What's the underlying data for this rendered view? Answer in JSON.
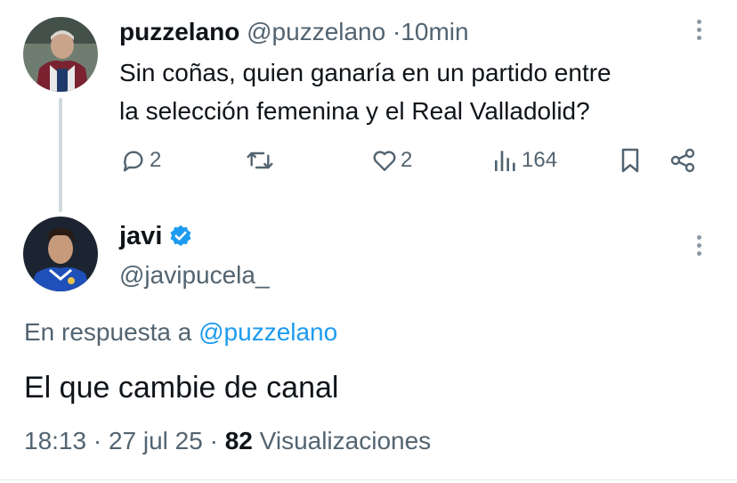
{
  "parent_tweet": {
    "author_name": "puzzelano",
    "author_handle": "@puzzelano",
    "separator": "·",
    "time_ago": "10min",
    "text_line1": "Sin coñas, quien ganaría en un partido entre",
    "text_line2": "la selección femenina y el Real Valladolid?",
    "actions": {
      "replies": "2",
      "likes": "2",
      "views": "164"
    },
    "avatar_icon": "avatar-photo-man-icon"
  },
  "reply_tweet": {
    "author_name": "javi",
    "author_handle": "@javipucela_",
    "verified": true,
    "reply_prefix": "En respuesta a",
    "reply_mention": "@puzzelano",
    "text": "El que cambie de canal",
    "time": "18:13",
    "date": "27 jul 25",
    "meta_separator": "·",
    "views_count": "82",
    "views_label": "Visualizaciones",
    "avatar_icon": "avatar-photo-young-man-icon"
  },
  "colors": {
    "text": "#0f1419",
    "muted": "#536471",
    "link": "#1d9bf0",
    "verified": "#1d9bf0",
    "thread_line": "#cfd9de"
  }
}
